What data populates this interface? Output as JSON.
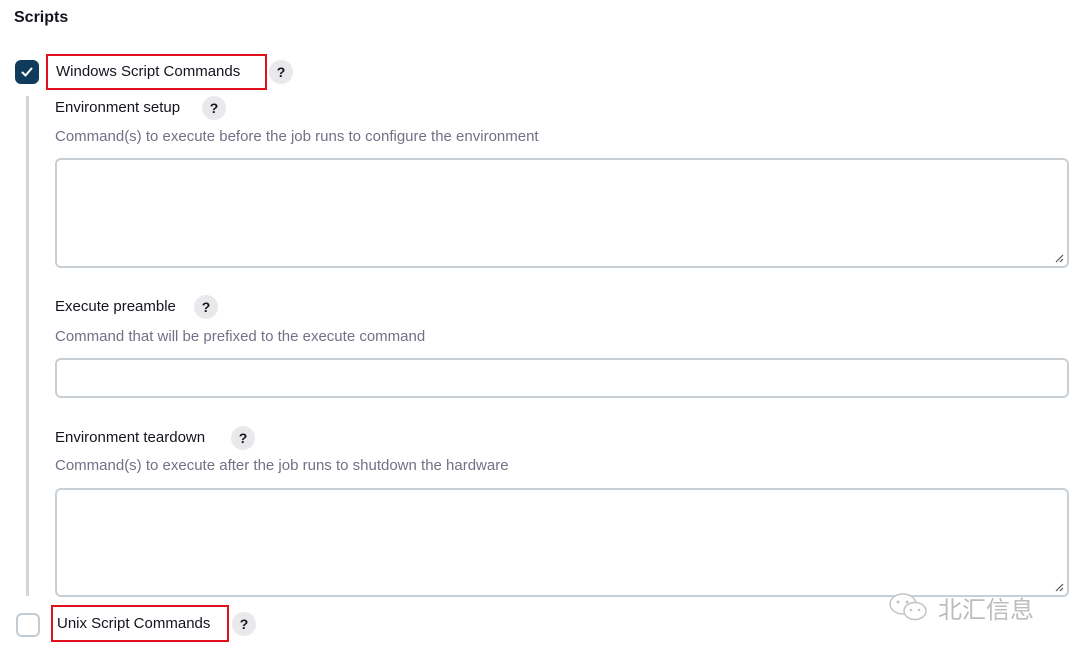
{
  "section": {
    "title": "Scripts"
  },
  "windows_option": {
    "label": "Windows Script Commands",
    "checked": true,
    "help": "?",
    "fields": [
      {
        "label": "Environment setup",
        "help": "?",
        "description": "Command(s) to execute before the job runs to configure the environment",
        "value": "",
        "type": "textarea"
      },
      {
        "label": "Execute preamble",
        "help": "?",
        "description": "Command that will be prefixed to the execute command",
        "value": "",
        "type": "input"
      },
      {
        "label": "Environment teardown",
        "help": "?",
        "description": "Command(s) to execute after the job runs to shutdown the hardware",
        "value": "",
        "type": "textarea"
      }
    ]
  },
  "unix_option": {
    "label": "Unix Script Commands",
    "checked": false,
    "help": "?"
  },
  "watermark": {
    "text": "北汇信息",
    "icon": "wechat-icon"
  },
  "colors": {
    "checkbox_checked": "#0f3c5a",
    "highlight_border": "#e0101d",
    "description_text": "#717187",
    "field_border": "#c8d0d6"
  }
}
